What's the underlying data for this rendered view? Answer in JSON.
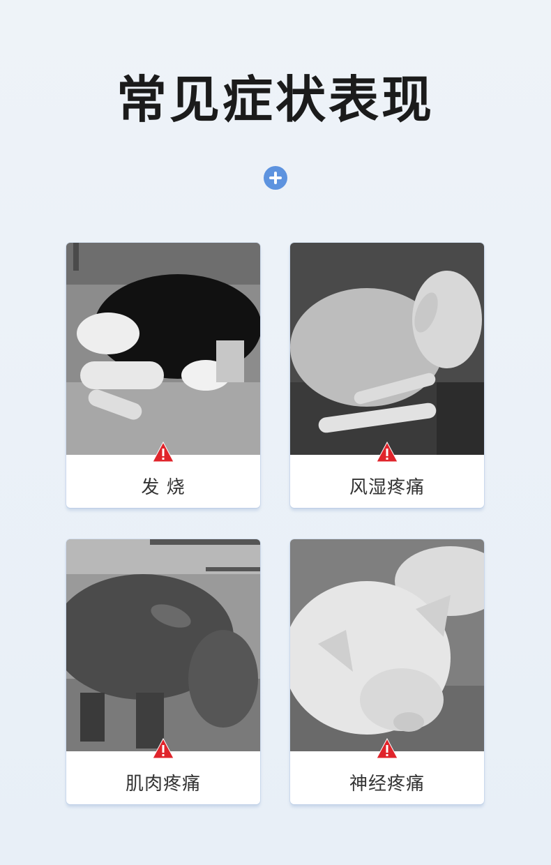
{
  "title": "常见症状表现",
  "colors": {
    "accent": "#5d93df",
    "warning": "#e0242b",
    "title": "#1b1b1b"
  },
  "cards": [
    {
      "label": "发 烧",
      "image": "calf-lying-photo"
    },
    {
      "label": "风湿疼痛",
      "image": "sheep-lying-photo"
    },
    {
      "label": "肌肉疼痛",
      "image": "cattle-standing-photo"
    },
    {
      "label": "神经疼痛",
      "image": "pig-lying-photo"
    }
  ]
}
